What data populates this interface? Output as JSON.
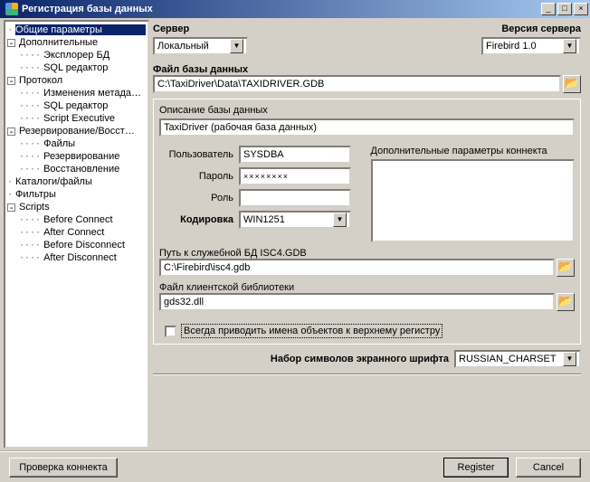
{
  "window": {
    "title": "Регистрация базы данных"
  },
  "tree": {
    "n0": "Общие параметры",
    "n1": "Дополнительные",
    "n1_0": "Эксплорер БД",
    "n1_1": "SQL редактор",
    "n2": "Протокол",
    "n2_0": "Изменения метадан…",
    "n2_1": "SQL редактор",
    "n2_2": "Script Executive",
    "n3": "Резервирование/Восст…",
    "n3_0": "Файлы",
    "n3_1": "Резервирование",
    "n3_2": "Восстановление",
    "n4": "Каталоги/файлы",
    "n5": "Фильтры",
    "n6": "Scripts",
    "n6_0": "Before Connect",
    "n6_1": "After Connect",
    "n6_2": "Before Disconnect",
    "n6_3": "After Disconnect"
  },
  "form": {
    "server_lbl": "Сервер",
    "server_val": "Локальный",
    "version_lbl": "Версия сервера",
    "version_val": "Firebird 1.0",
    "dbfile_lbl": "Файл базы данных",
    "dbfile_val": "C:\\TaxiDriver\\Data\\TAXIDRIVER.GDB",
    "desc_lbl": "Описание базы данных",
    "desc_val": "TaxiDriver (рабочая база данных)",
    "user_lbl": "Пользователь",
    "user_val": "SYSDBA",
    "pass_lbl": "Пароль",
    "pass_val": "××××××××",
    "role_lbl": "Роль",
    "role_val": "",
    "enc_lbl": "Кодировка",
    "enc_val": "WIN1251",
    "extra_lbl": "Дополнительные параметры коннекта",
    "isc_lbl": "Путь к служебной БД ISC4.GDB",
    "isc_val": "C:\\Firebird\\isc4.gdb",
    "lib_lbl": "Файл клиентской библиотеки",
    "lib_val": "gds32.dll",
    "upper_lbl": "Всегда приводить имена объектов к верхнему регистру",
    "charset_lbl": "Набор символов экранного шрифта",
    "charset_val": "RUSSIAN_CHARSET"
  },
  "buttons": {
    "test": "Проверка коннекта",
    "register": "Register",
    "cancel": "Cancel"
  }
}
